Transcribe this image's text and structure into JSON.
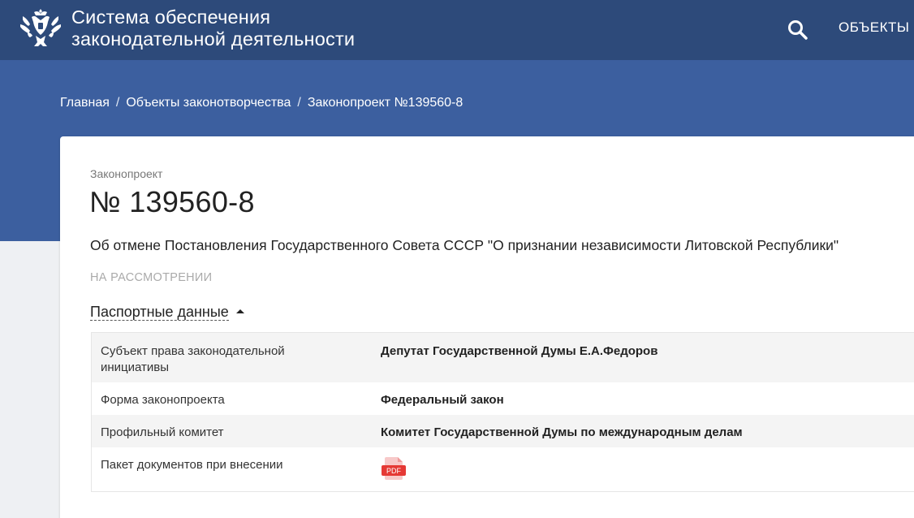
{
  "header": {
    "title_line1": "Система обеспечения",
    "title_line2": "законодательной деятельности",
    "nav_objects": "ОБЪЕКТЫ"
  },
  "breadcrumb": {
    "home": "Главная",
    "section": "Объекты законотворчества",
    "current": "Законопроект №139560-8"
  },
  "bill": {
    "type": "Законопроект",
    "number": "№ 139560-8",
    "name": "Об отмене Постановления Государственного Совета СССР \"О признании независимости Литовской Республики\"",
    "status": "НА РАССМОТРЕНИИ"
  },
  "passport": {
    "toggle_label": "Паспортные данные",
    "rows": [
      {
        "label": "Субъект права законодательной инициативы",
        "value": "Депутат Государственной Думы Е.А.Федоров"
      },
      {
        "label": "Форма законопроекта",
        "value": "Федеральный закон"
      },
      {
        "label": "Профильный комитет",
        "value": "Комитет Государственной Думы по международным делам"
      },
      {
        "label": "Пакет документов при внесении",
        "value": "PDF"
      }
    ]
  },
  "icons": {
    "emblem": "coat-of-arms-icon",
    "search": "search-icon",
    "pdf": "pdf-file-icon"
  },
  "colors": {
    "header": "#2d4a7a",
    "hero": "#3c5f9f",
    "pdf": "#e53935"
  }
}
